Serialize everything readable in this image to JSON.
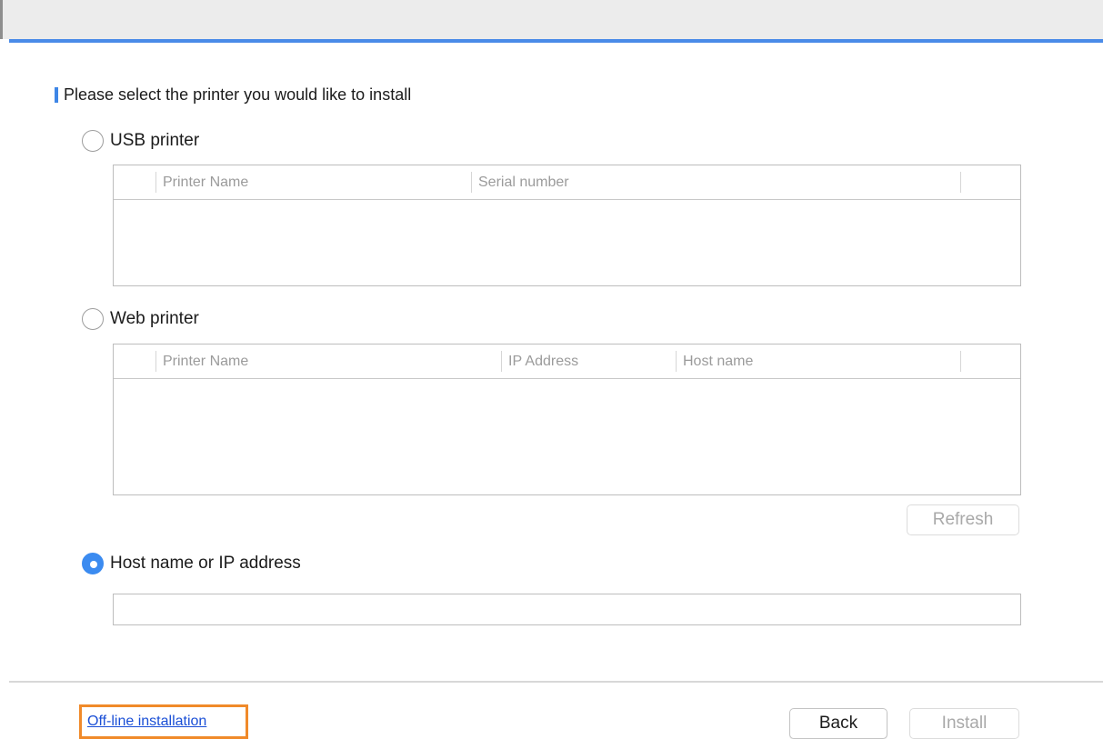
{
  "heading": "Please select the printer you would like to install",
  "usb": {
    "label": "USB printer",
    "columns": [
      "Printer Name",
      "Serial number"
    ]
  },
  "web": {
    "label": "Web printer",
    "columns": [
      "Printer Name",
      "IP Address",
      "Host name"
    ]
  },
  "refresh_label": "Refresh",
  "host": {
    "label": "Host name or IP address",
    "value": ""
  },
  "offline_link": "Off-line installation",
  "buttons": {
    "back": "Back",
    "install": "Install"
  },
  "colors": {
    "accent": "#4a8be8",
    "radio_selected": "#3b8bf0",
    "link": "#1a4fd6",
    "highlight_box": "#f08a2a"
  }
}
